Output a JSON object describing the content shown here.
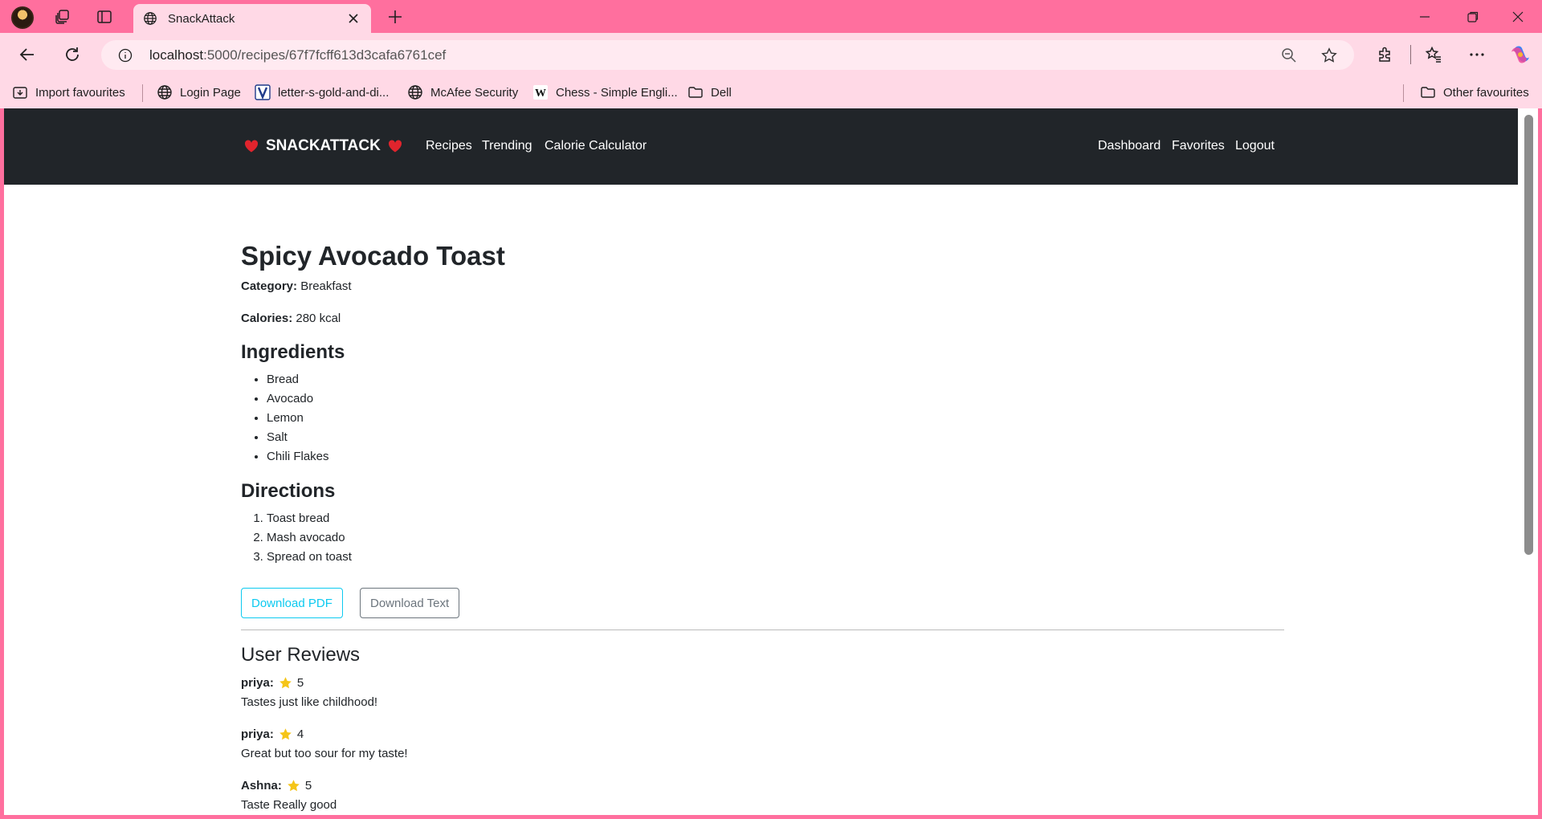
{
  "browser": {
    "tab_title": "SnackAttack",
    "url_host": "localhost",
    "url_rest": ":5000/recipes/67f7fcff613d3cafa6761cef",
    "bookmarks": [
      {
        "label": "Import favourites",
        "icon": "import-icon"
      },
      {
        "label": "Login Page",
        "icon": "globe-icon"
      },
      {
        "label": "letter-s-gold-and-di...",
        "icon": "v-logo-icon"
      },
      {
        "label": "McAfee Security",
        "icon": "globe-icon"
      },
      {
        "label": "Chess - Simple Engli...",
        "icon": "wikipedia-icon"
      },
      {
        "label": "Dell",
        "icon": "folder-icon"
      }
    ],
    "other_favourites": "Other favourites"
  },
  "site": {
    "brand": "SNACKATTACK",
    "nav_left": [
      "Recipes",
      "Trending",
      "Calorie Calculator"
    ],
    "nav_right": [
      "Dashboard",
      "Favorites",
      "Logout"
    ]
  },
  "recipe": {
    "title": "Spicy Avocado Toast",
    "category_label": "Category:",
    "category": "Breakfast",
    "calories_label": "Calories:",
    "calories": "280 kcal",
    "ingredients_heading": "Ingredients",
    "ingredients": [
      "Bread",
      "Avocado",
      "Lemon",
      "Salt",
      "Chili Flakes"
    ],
    "directions_heading": "Directions",
    "directions": [
      "Toast bread",
      "Mash avocado",
      "Spread on toast"
    ],
    "download_pdf": "Download PDF",
    "download_text": "Download Text"
  },
  "reviews": {
    "heading": "User Reviews",
    "items": [
      {
        "user": "priya:",
        "rating": "5",
        "text": "Tastes just like childhood!"
      },
      {
        "user": "priya:",
        "rating": "4",
        "text": "Great but too sour for my taste!"
      },
      {
        "user": "Ashna:",
        "rating": "5",
        "text": "Taste Really good"
      }
    ]
  },
  "colors": {
    "browser_frame": "#ff6f9e",
    "browser_toolbar": "#ffd9e6",
    "site_nav": "#212529",
    "pdf_button": "#0dcaf0",
    "text_button": "#6c757d",
    "star": "#f5c518",
    "heart": "#e0242d"
  }
}
